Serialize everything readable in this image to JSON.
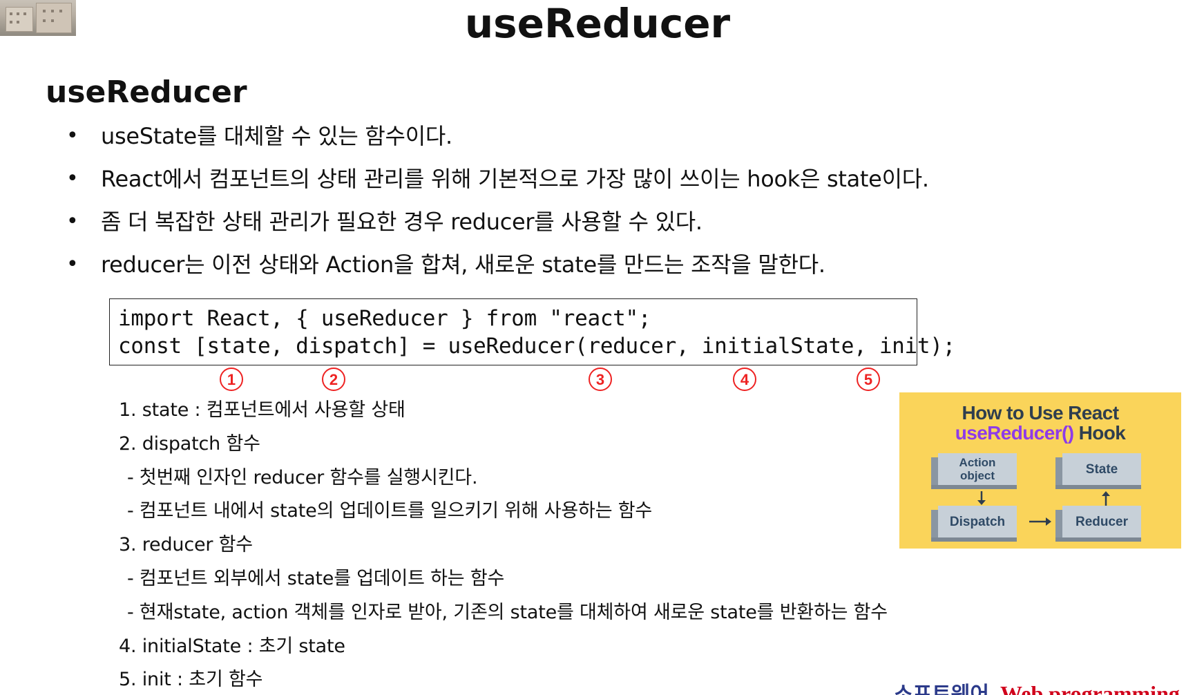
{
  "slide": {
    "title": "useReducer"
  },
  "section": {
    "title": "useReducer"
  },
  "bullets": [
    "useState를 대체할 수 있는 함수이다.",
    "React에서 컴포넌트의 상태 관리를 위해 기본적으로 가장 많이 쓰이는 hook은 state이다.",
    "좀 더 복잡한 상태 관리가 필요한 경우 reducer를 사용할 수 있다.",
    "reducer는 이전 상태와 Action을 합쳐, 새로운 state를 만드는 조작을 말한다."
  ],
  "bullet_symbol": "•",
  "code": {
    "line1": "import React, { useReducer } from \"react\";",
    "line2": "const [state, dispatch] = useReducer(reducer, initialState, init);"
  },
  "markers": [
    "1",
    "2",
    "3",
    "4",
    "5"
  ],
  "details": [
    "1. state : 컴포넌트에서 사용할 상태",
    "2. dispatch 함수",
    "- 첫번째 인자인 reducer 함수를 실행시킨다.",
    "- 컴포넌트 내에서 state의 업데이트를 일으키기 위해 사용하는 함수",
    "3. reducer 함수",
    "- 컴포넌트 외부에서 state를 업데이트 하는 함수",
    "- 현재state, action 객체를 인자로 받아, 기존의 state를 대체하여 새로운 state를 반환하는 함수",
    "4. initialState : 초기 state",
    "5. init : 초기 함수"
  ],
  "diagram": {
    "title_line1": "How to Use React",
    "title_line2_accent": "useReducer()",
    "title_line2_rest": " Hook",
    "boxes": {
      "action_object": "Action object",
      "state": "State",
      "dispatch": "Dispatch",
      "reducer": "Reducer"
    },
    "colors": {
      "background": "#fad45a",
      "accent": "#8e3be8",
      "box": "#c7d0d8"
    }
  },
  "footer": {
    "brand_kr": "소프트웨어",
    "brand_en": "Web programming"
  },
  "colors": {
    "marker": "#e22222"
  }
}
